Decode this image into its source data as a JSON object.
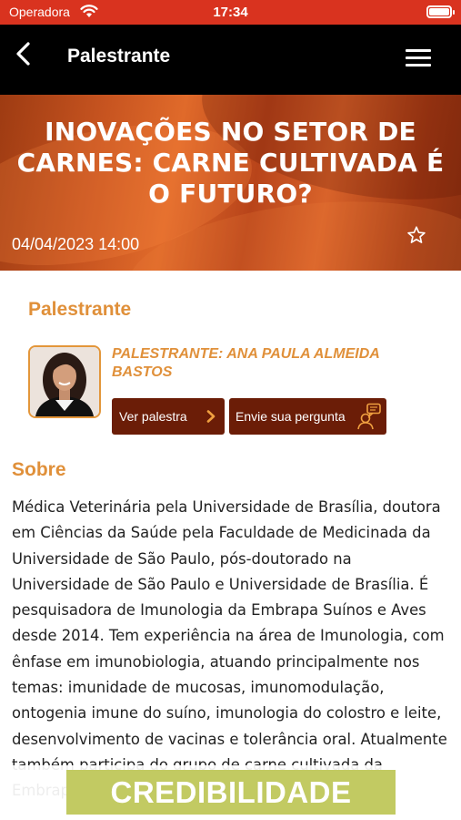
{
  "status_bar": {
    "carrier": "Operadora",
    "time": "17:34"
  },
  "nav": {
    "title": "Palestrante"
  },
  "banner": {
    "title": "INOVAÇÕES NO SETOR DE CARNES: CARNE CULTIVADA É O FUTURO? ",
    "datetime": "04/04/2023 14:00"
  },
  "speaker_section": {
    "heading": "Palestrante",
    "speaker_name": "PALESTRANTE: ANA PAULA ALMEIDA BASTOS",
    "view_talk_button": "Ver palestra",
    "ask_button": "Envie sua pergunta"
  },
  "about": {
    "heading": "Sobre",
    "text": "Médica Veterinária pela Universidade de Brasília, doutora em Ciências da Saúde pela Faculdade de Medicinada da Universidade de São Paulo, pós-doutorado na Universidade de São Paulo e Universidade de Brasília. É pesquisadora de Imunologia da Embrapa Suínos e Aves desde 2014. Tem experiência na área de Imunologia, com ênfase em imunobiologia, atuando principalmente nos temas: imunidade de mucosas, imunomodulação, ontogenia imune do suíno, imunologia do colostro e leite, desenvolvimento de vacinas e tolerância oral. Atualmente também participa do grupo de carne cultivada da Embrapa. Gestora do Núcleo"
  },
  "ad_banner": {
    "text": "CREDIBILIDADE",
    "color": "#c2ca62"
  },
  "colors": {
    "status_bar": "#d9331f",
    "nav_bar": "#000000",
    "accent": "#e0903a",
    "button": "#6b1d07"
  },
  "icons": [
    "wifi-icon",
    "battery-icon",
    "back-chevron-icon",
    "hamburger-menu-icon",
    "star-outline-icon",
    "chevron-right-icon",
    "ask-question-icon"
  ]
}
